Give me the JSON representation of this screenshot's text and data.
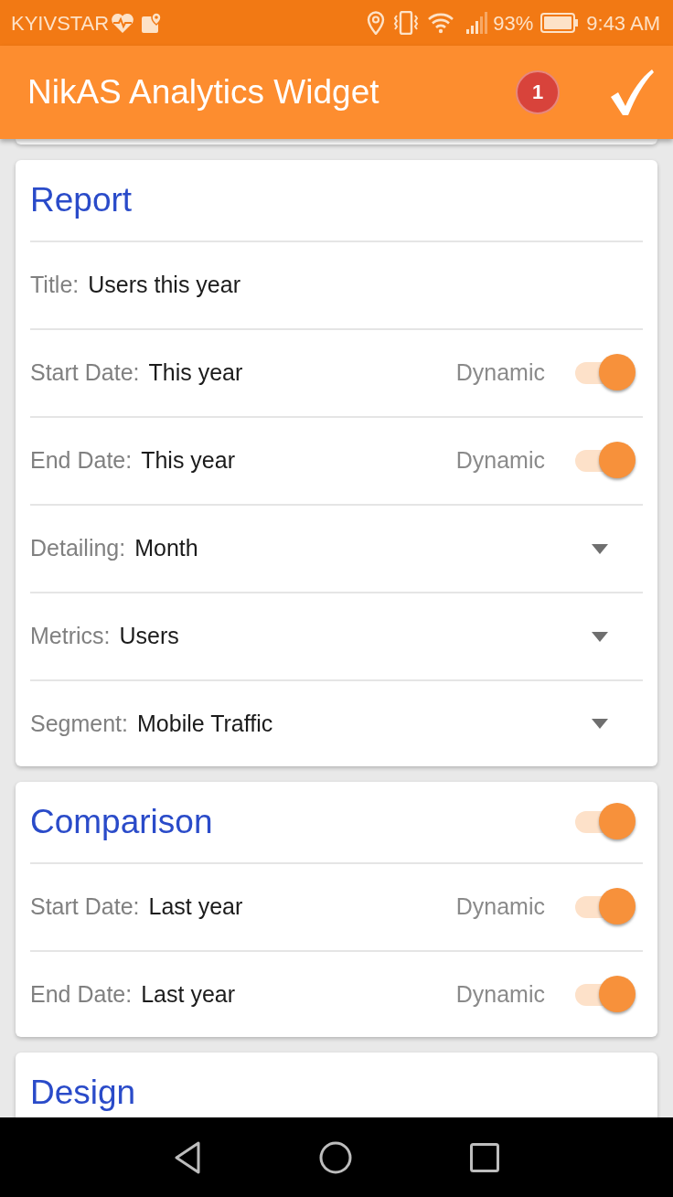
{
  "status_bar": {
    "carrier": "KYIVSTAR",
    "battery": "93%",
    "time": "9:43 AM"
  },
  "app_bar": {
    "title": "NikAS Analytics Widget",
    "badge": "1"
  },
  "sections": [
    {
      "title": "Report",
      "kind": "plain",
      "rows": [
        {
          "kind": "text",
          "label": "Title:",
          "value": "Users this year"
        },
        {
          "kind": "switch",
          "label": "Start Date:",
          "value": "This year",
          "switch_label": "Dynamic",
          "on": true
        },
        {
          "kind": "switch",
          "label": "End Date:",
          "value": "This year",
          "switch_label": "Dynamic",
          "on": true
        },
        {
          "kind": "dropdown",
          "label": "Detailing:",
          "value": "Month"
        },
        {
          "kind": "dropdown",
          "label": "Metrics:",
          "value": "Users"
        },
        {
          "kind": "dropdown",
          "label": "Segment:",
          "value": "Mobile Traffic"
        }
      ]
    },
    {
      "title": "Comparison",
      "kind": "switch",
      "on": true,
      "rows": [
        {
          "kind": "switch",
          "label": "Start Date:",
          "value": "Last year",
          "switch_label": "Dynamic",
          "on": true
        },
        {
          "kind": "switch",
          "label": "End Date:",
          "value": "Last year",
          "switch_label": "Dynamic",
          "on": true
        }
      ]
    },
    {
      "title": "Design",
      "kind": "plain"
    }
  ]
}
